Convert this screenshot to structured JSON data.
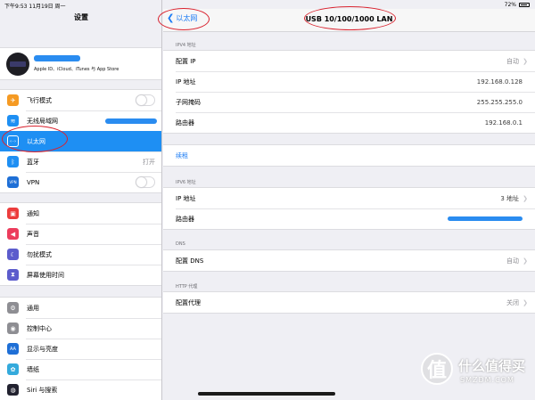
{
  "status_bar": {
    "time_date": "下午9:53   11月19日 周一",
    "battery": "72%"
  },
  "sidebar": {
    "title": "设置",
    "profile_subtitle": "Apple ID、iCloud、iTunes 与 App Store",
    "group1": [
      {
        "label": "飞行模式",
        "icon": "airplane-icon",
        "color": "#f59a23",
        "glyph": "✈"
      },
      {
        "label": "无线局域网",
        "icon": "wifi-icon",
        "color": "#1e8ff3",
        "glyph": "≋"
      },
      {
        "label": "以太网",
        "icon": "ethernet-icon",
        "color": "#1e8ff3",
        "glyph": "‹··›"
      },
      {
        "label": "蓝牙",
        "icon": "bluetooth-icon",
        "color": "#1e8ff3",
        "glyph": "ᛒ",
        "value": "打开"
      },
      {
        "label": "VPN",
        "icon": "vpn-icon",
        "color": "#1e6fd6",
        "glyph": "VPN"
      }
    ],
    "group2": [
      {
        "label": "通知",
        "icon": "notifications-icon",
        "color": "#ec3c3c",
        "glyph": "▣"
      },
      {
        "label": "声音",
        "icon": "sound-icon",
        "color": "#ec3c5c",
        "glyph": "◀"
      },
      {
        "label": "勿扰模式",
        "icon": "moon-icon",
        "color": "#5c5ccc",
        "glyph": "☾"
      },
      {
        "label": "屏幕使用时间",
        "icon": "hourglass-icon",
        "color": "#5c5ccc",
        "glyph": "⧗"
      }
    ],
    "group3": [
      {
        "label": "通用",
        "icon": "gear-icon",
        "color": "#8e8e93",
        "glyph": "⚙"
      },
      {
        "label": "控制中心",
        "icon": "control-center-icon",
        "color": "#8e8e93",
        "glyph": "◉"
      },
      {
        "label": "显示与亮度",
        "icon": "display-icon",
        "color": "#1e6fd6",
        "glyph": "AA"
      },
      {
        "label": "墙纸",
        "icon": "wallpaper-icon",
        "color": "#34aadc",
        "glyph": "✿"
      },
      {
        "label": "Siri 与搜索",
        "icon": "siri-icon",
        "color": "#222230",
        "glyph": "◍"
      }
    ]
  },
  "nav": {
    "back_label": "以太网",
    "title": "USB 10/100/1000 LAN"
  },
  "ipv4": {
    "header": "IPV4 地址",
    "rows": [
      {
        "label": "配置 IP",
        "value": "自动"
      },
      {
        "label": "IP 地址",
        "value": "192.168.0.128"
      },
      {
        "label": "子网掩码",
        "value": "255.255.255.0"
      },
      {
        "label": "路由器",
        "value": "192.168.0.1"
      }
    ]
  },
  "renew_label": "续租",
  "ipv6": {
    "header": "IPV6 地址",
    "rows": [
      {
        "label": "IP 地址",
        "value": "3 地址"
      },
      {
        "label": "路由器",
        "value": ""
      }
    ]
  },
  "dns": {
    "header": "DNS",
    "label": "配置 DNS",
    "value": "自动"
  },
  "proxy": {
    "header": "HTTP 代理",
    "label": "配置代理",
    "value": "关闭"
  },
  "watermark": {
    "text": "什么值得买",
    "sub": "SMZDM.COM",
    "logo": "值"
  }
}
